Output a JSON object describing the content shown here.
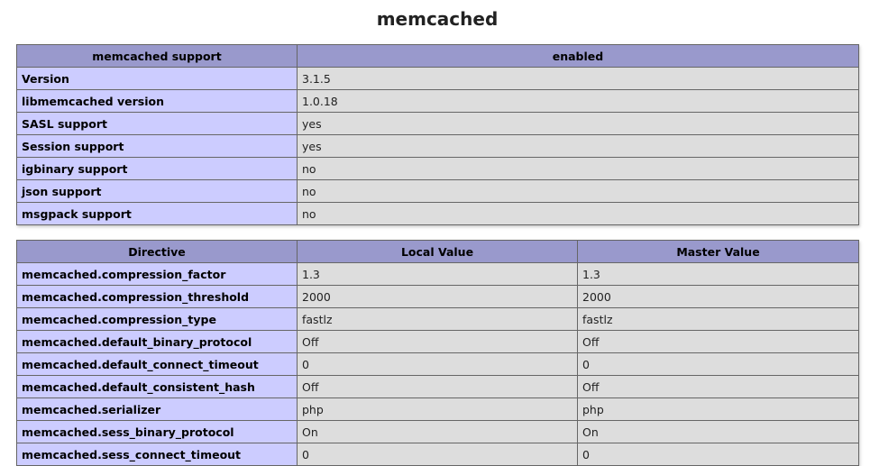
{
  "module_title": "memcached",
  "support_table": {
    "header": [
      "memcached support",
      "enabled"
    ],
    "rows": [
      [
        "Version",
        "3.1.5"
      ],
      [
        "libmemcached version",
        "1.0.18"
      ],
      [
        "SASL support",
        "yes"
      ],
      [
        "Session support",
        "yes"
      ],
      [
        "igbinary support",
        "no"
      ],
      [
        "json support",
        "no"
      ],
      [
        "msgpack support",
        "no"
      ]
    ]
  },
  "directive_table": {
    "header": [
      "Directive",
      "Local Value",
      "Master Value"
    ],
    "rows": [
      [
        "memcached.compression_factor",
        "1.3",
        "1.3"
      ],
      [
        "memcached.compression_threshold",
        "2000",
        "2000"
      ],
      [
        "memcached.compression_type",
        "fastlz",
        "fastlz"
      ],
      [
        "memcached.default_binary_protocol",
        "Off",
        "Off"
      ],
      [
        "memcached.default_connect_timeout",
        "0",
        "0"
      ],
      [
        "memcached.default_consistent_hash",
        "Off",
        "Off"
      ],
      [
        "memcached.serializer",
        "php",
        "php"
      ],
      [
        "memcached.sess_binary_protocol",
        "On",
        "On"
      ],
      [
        "memcached.sess_connect_timeout",
        "0",
        "0"
      ]
    ]
  },
  "colors": {
    "header_bg": "#9999cc",
    "key_bg": "#ccccff",
    "value_bg": "#dddddd",
    "border": "#666666"
  }
}
